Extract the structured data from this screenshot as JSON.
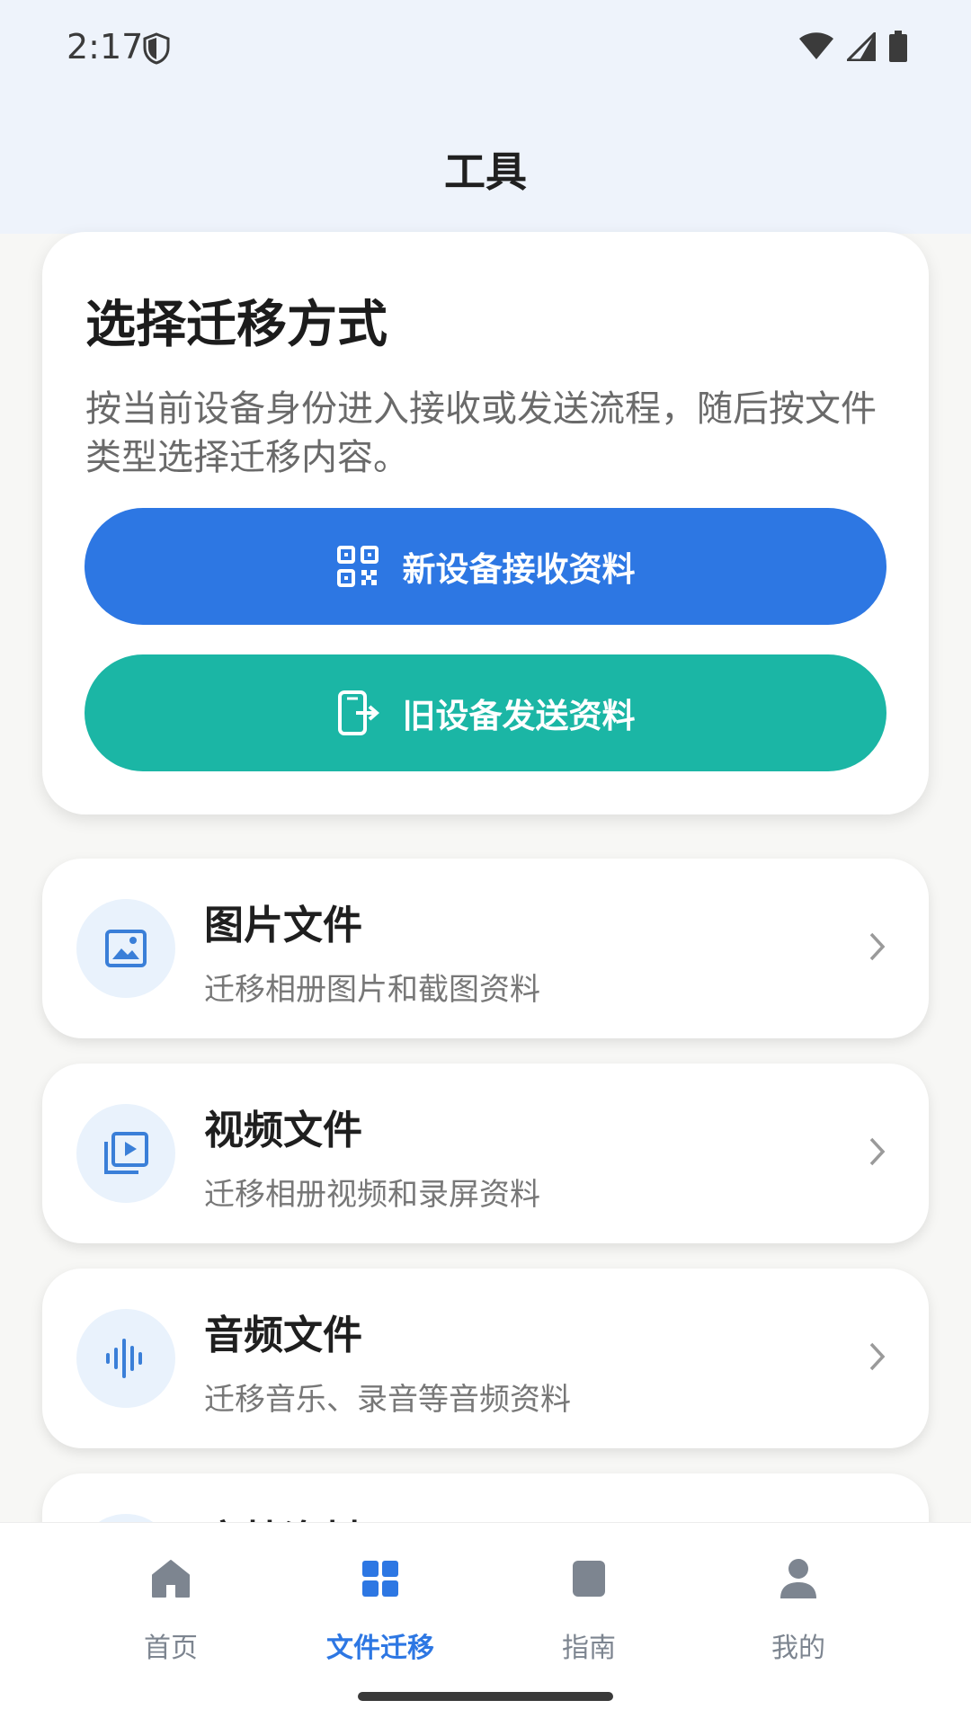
{
  "status_bar": {
    "time": "2:17"
  },
  "app_bar": {
    "title": "工具"
  },
  "hero": {
    "title": "选择迁移方式",
    "description": "按当前设备身份进入接收或发送流程，随后按文件类型选择迁移内容。",
    "receive_button": "新设备接收资料",
    "send_button": "旧设备发送资料"
  },
  "file_types": [
    {
      "title": "图片文件",
      "subtitle": "迁移相册图片和截图资料",
      "icon": "image-icon"
    },
    {
      "title": "视频文件",
      "subtitle": "迁移相册视频和录屏资料",
      "icon": "video-icon"
    },
    {
      "title": "音频文件",
      "subtitle": "迁移音乐、录音等音频资料",
      "icon": "audio-wave-icon"
    },
    {
      "title": "文档资料",
      "subtitle": "",
      "icon": "document-icon"
    }
  ],
  "bottom_nav": [
    {
      "label": "首页",
      "icon": "home-icon",
      "active": false
    },
    {
      "label": "文件迁移",
      "icon": "grid-icon",
      "active": true
    },
    {
      "label": "指南",
      "icon": "book-icon",
      "active": false
    },
    {
      "label": "我的",
      "icon": "person-icon",
      "active": false
    }
  ],
  "colors": {
    "primary_blue": "#2d77e3",
    "teal": "#1bb6a5",
    "header_bg": "#eef3fb",
    "icon_circle": "#e9f2fc"
  }
}
